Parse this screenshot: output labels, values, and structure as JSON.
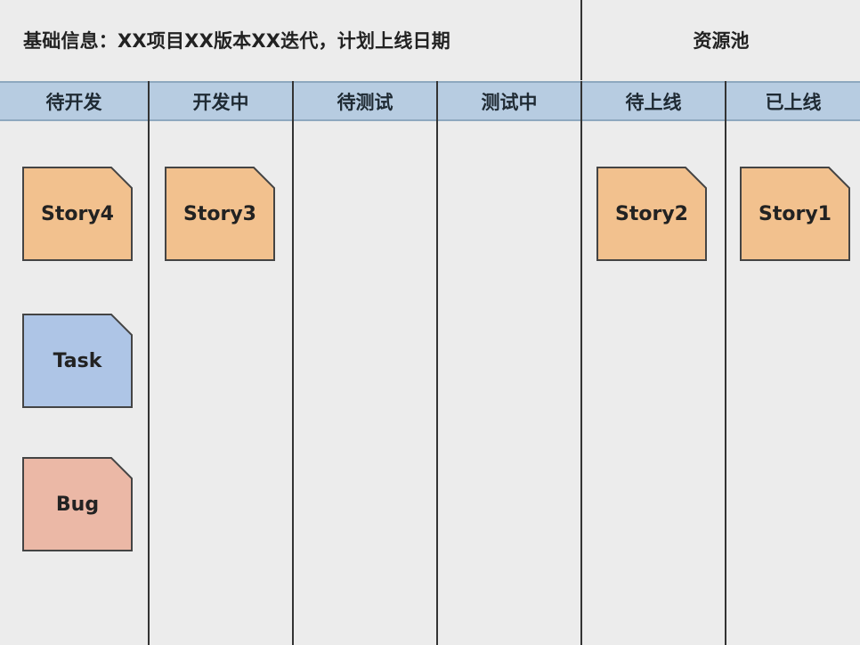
{
  "header": {
    "basic_info": "基础信息：XX项目XX版本XX迭代，计划上线日期",
    "resource_pool": "资源池"
  },
  "columns": [
    {
      "label": "待开发"
    },
    {
      "label": "开发中"
    },
    {
      "label": "待测试"
    },
    {
      "label": "测试中"
    },
    {
      "label": "待上线"
    },
    {
      "label": "已上线"
    }
  ],
  "cards": [
    {
      "label": "Story4",
      "color": "#f2c18e"
    },
    {
      "label": "Task",
      "color": "#aec5e6"
    },
    {
      "label": "Bug",
      "color": "#ebb8a6"
    },
    {
      "label": "Story3",
      "color": "#f2c18e"
    },
    {
      "label": "Story2",
      "color": "#f2c18e"
    },
    {
      "label": "Story1",
      "color": "#f2c18e"
    }
  ]
}
